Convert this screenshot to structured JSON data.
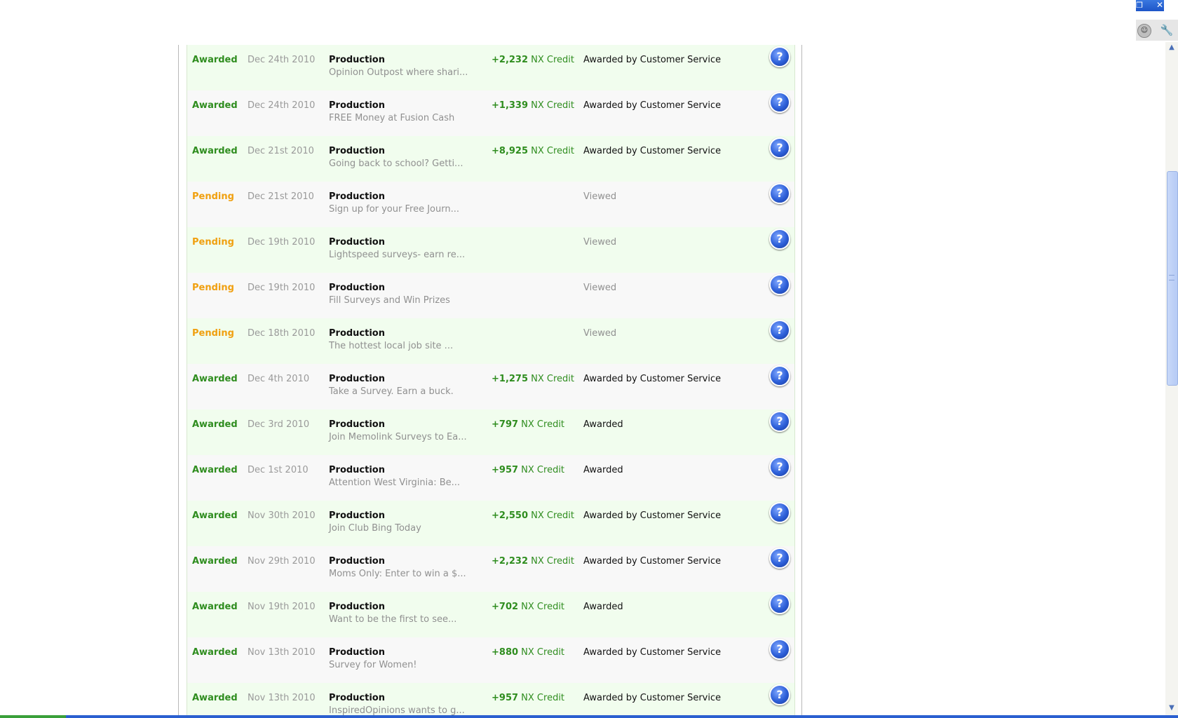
{
  "window": {
    "restore_glyph": "❐",
    "close_glyph": "✕",
    "smiley_icon_glyph": "☺",
    "wrench_icon_glyph": "🔧"
  },
  "transactions": [
    {
      "status": "Awarded",
      "status_type": "awarded",
      "date": "Dec 24th 2010",
      "category": "Production",
      "description": "Opinion Outpost where shari...",
      "amount": "+2,232",
      "currency": "NX Credit",
      "note": "Awarded by Customer Service",
      "note_type": "normal"
    },
    {
      "status": "Awarded",
      "status_type": "awarded",
      "date": "Dec 24th 2010",
      "category": "Production",
      "description": "FREE Money at Fusion Cash",
      "amount": "+1,339",
      "currency": "NX Credit",
      "note": "Awarded by Customer Service",
      "note_type": "normal"
    },
    {
      "status": "Awarded",
      "status_type": "awarded",
      "date": "Dec 21st 2010",
      "category": "Production",
      "description": "Going back to school? Getti...",
      "amount": "+8,925",
      "currency": "NX Credit",
      "note": "Awarded by Customer Service",
      "note_type": "normal"
    },
    {
      "status": "Pending",
      "status_type": "pending",
      "date": "Dec 21st 2010",
      "category": "Production",
      "description": "Sign up for your Free Journ...",
      "amount": "",
      "currency": "",
      "note": "Viewed",
      "note_type": "viewed"
    },
    {
      "status": "Pending",
      "status_type": "pending",
      "date": "Dec 19th 2010",
      "category": "Production",
      "description": "Lightspeed surveys- earn re...",
      "amount": "",
      "currency": "",
      "note": "Viewed",
      "note_type": "viewed"
    },
    {
      "status": "Pending",
      "status_type": "pending",
      "date": "Dec 19th 2010",
      "category": "Production",
      "description": "Fill Surveys and Win Prizes",
      "amount": "",
      "currency": "",
      "note": "Viewed",
      "note_type": "viewed"
    },
    {
      "status": "Pending",
      "status_type": "pending",
      "date": "Dec 18th 2010",
      "category": "Production",
      "description": "The hottest local job site ...",
      "amount": "",
      "currency": "",
      "note": "Viewed",
      "note_type": "viewed"
    },
    {
      "status": "Awarded",
      "status_type": "awarded",
      "date": "Dec 4th 2010",
      "category": "Production",
      "description": "Take a Survey. Earn a buck.",
      "amount": "+1,275",
      "currency": "NX Credit",
      "note": "Awarded by Customer Service",
      "note_type": "normal"
    },
    {
      "status": "Awarded",
      "status_type": "awarded",
      "date": "Dec 3rd 2010",
      "category": "Production",
      "description": "Join Memolink Surveys to Ea...",
      "amount": "+797",
      "currency": "NX Credit",
      "note": "Awarded",
      "note_type": "normal"
    },
    {
      "status": "Awarded",
      "status_type": "awarded",
      "date": "Dec 1st 2010",
      "category": "Production",
      "description": "Attention West Virginia: Be...",
      "amount": "+957",
      "currency": "NX Credit",
      "note": "Awarded",
      "note_type": "normal"
    },
    {
      "status": "Awarded",
      "status_type": "awarded",
      "date": "Nov 30th 2010",
      "category": "Production",
      "description": "Join Club Bing Today",
      "amount": "+2,550",
      "currency": "NX Credit",
      "note": "Awarded by Customer Service",
      "note_type": "normal"
    },
    {
      "status": "Awarded",
      "status_type": "awarded",
      "date": "Nov 29th 2010",
      "category": "Production",
      "description": "Moms Only: Enter to win a $...",
      "amount": "+2,232",
      "currency": "NX Credit",
      "note": "Awarded by Customer Service",
      "note_type": "normal"
    },
    {
      "status": "Awarded",
      "status_type": "awarded",
      "date": "Nov 19th 2010",
      "category": "Production",
      "description": "Want to be the first to see...",
      "amount": "+702",
      "currency": "NX Credit",
      "note": "Awarded",
      "note_type": "normal"
    },
    {
      "status": "Awarded",
      "status_type": "awarded",
      "date": "Nov 13th 2010",
      "category": "Production",
      "description": "Survey for Women!",
      "amount": "+880",
      "currency": "NX Credit",
      "note": "Awarded by Customer Service",
      "note_type": "normal"
    },
    {
      "status": "Awarded",
      "status_type": "awarded",
      "date": "Nov 13th 2010",
      "category": "Production",
      "description": "InspiredOpinions wants to g...",
      "amount": "+957",
      "currency": "NX Credit",
      "note": "Awarded by Customer Service",
      "note_type": "normal"
    }
  ],
  "help_icon": {
    "glyph": "?"
  },
  "colors": {
    "awarded": "#2f8d1f",
    "pending": "#f0a010",
    "row_even": "#f1fdee",
    "row_odd": "#f8f8f8",
    "help_blue": "#2d5fd8"
  }
}
